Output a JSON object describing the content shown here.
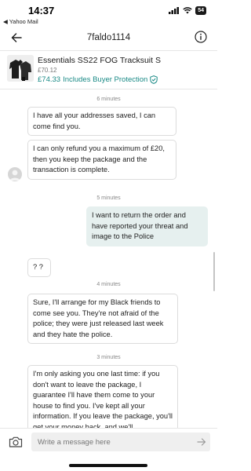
{
  "status_bar": {
    "time": "14:37",
    "back_app": "◀ Yahoo Mail",
    "battery": "54"
  },
  "nav": {
    "title": "7faldo1114"
  },
  "product": {
    "title": "Essentials SS22 FOG Tracksuit S",
    "price": "£70.12",
    "buyer_price": "£74.33",
    "buyer_protection": "Includes Buyer Protection"
  },
  "messages": [
    {
      "type": "timestamp",
      "text": "6 minutes"
    },
    {
      "type": "them",
      "text": "I have all your addresses saved, I can come find you."
    },
    {
      "type": "them",
      "text": "I can only refund you a maximum of £20, then you keep the package and the transaction is complete."
    },
    {
      "type": "timestamp",
      "text": "5 minutes"
    },
    {
      "type": "me",
      "text": "I want to return the order and have reported your threat and image to the Police"
    },
    {
      "type": "them",
      "text": "? ?"
    },
    {
      "type": "timestamp",
      "text": "4 minutes"
    },
    {
      "type": "them",
      "text": "Sure, I'll arrange for my Black friends to come see you. They're not afraid of the police; they were just released last week and they hate the police."
    },
    {
      "type": "timestamp",
      "text": "3 minutes"
    },
    {
      "type": "them",
      "text": "I'm only asking you one last time: if you don't want to leave the package, I guarantee I'll have them come to your house to find you. I've kept all your information. If you leave the package, you'll get your money back, and we'll"
    }
  ],
  "composer": {
    "placeholder": "Write a message here"
  },
  "colors": {
    "accent": "#1a8a86",
    "my_bubble": "#e6f0ef"
  }
}
